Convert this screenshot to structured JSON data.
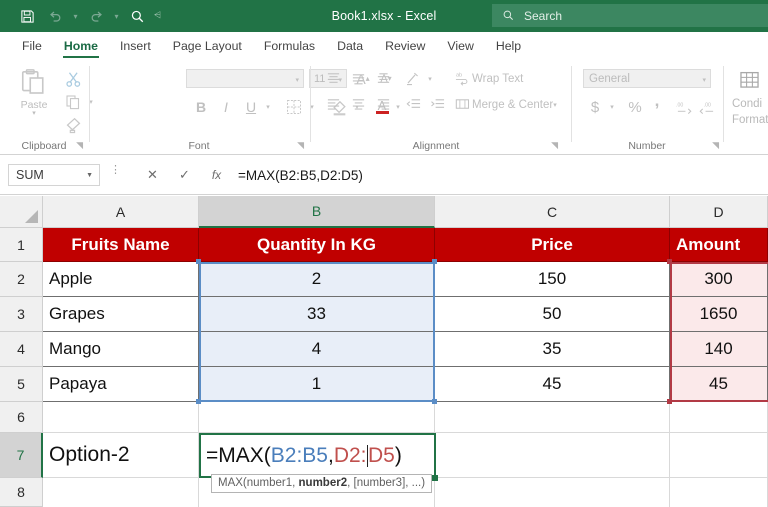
{
  "titlebar": {
    "document_title": "Book1.xlsx  -  Excel",
    "quick_access": [
      {
        "name": "save-icon",
        "label": "Save"
      },
      {
        "name": "undo-icon",
        "label": "Undo"
      },
      {
        "name": "redo-icon",
        "label": "Redo"
      },
      {
        "name": "search-icon",
        "label": "Search"
      },
      {
        "name": "customize-quick-access-icon",
        "label": "Customize Quick Access Toolbar"
      }
    ],
    "search": {
      "placeholder": "Search",
      "icon": "magnifier-icon"
    },
    "colors": {
      "bar": "#217346",
      "search_field": "#3c8761"
    }
  },
  "tabs": [
    {
      "label": "File",
      "active": false
    },
    {
      "label": "Home",
      "active": true
    },
    {
      "label": "Insert",
      "active": false
    },
    {
      "label": "Page Layout",
      "active": false
    },
    {
      "label": "Formulas",
      "active": false
    },
    {
      "label": "Data",
      "active": false
    },
    {
      "label": "Review",
      "active": false
    },
    {
      "label": "View",
      "active": false
    },
    {
      "label": "Help",
      "active": false
    }
  ],
  "ribbon": {
    "groups": [
      {
        "label": "Clipboard"
      },
      {
        "label": "Font"
      },
      {
        "label": "Alignment"
      },
      {
        "label": "Number"
      },
      {
        "label": "Conditional Formatting"
      }
    ],
    "clipboard": {
      "paste_label": "Paste",
      "cut_icon": "scissors-icon",
      "copy_icon": "copy-icon",
      "format_painter_icon": "format-painter-icon"
    },
    "font": {
      "font_name_value": "",
      "font_size_value": "11",
      "grow_font_label": "A",
      "shrink_font_label": "A",
      "bold_label": "B",
      "italic_label": "I",
      "underline_label": "U",
      "borders_icon": "borders-icon",
      "fill_color_icon": "fill-color-icon",
      "font_color_label": "A"
    },
    "alignment": {
      "wrap_text_label": "Wrap Text",
      "merge_center_label": "Merge & Center",
      "orientation_icon": "orientation-icon",
      "decrease_indent_icon": "decrease-indent-icon",
      "increase_indent_icon": "increase-indent-icon"
    },
    "number": {
      "format_value": "General",
      "accounting_label": "$",
      "percent_label": "%",
      "comma_label": ",",
      "increase_decimal_icon": "increase-decimal-icon",
      "decrease_decimal_icon": "decrease-decimal-icon"
    },
    "styles": {
      "conditional_formatting_line1": "Condi",
      "conditional_formatting_line2": "Format"
    }
  },
  "formula_bar": {
    "name_box_value": "SUM",
    "cancel_label": "✕",
    "enter_label": "✓",
    "function_label": "fx",
    "formula_value": "=MAX(B2:B5,D2:D5)"
  },
  "grid": {
    "column_headers": [
      {
        "label": "A",
        "selected": false
      },
      {
        "label": "B",
        "selected": true
      },
      {
        "label": "C",
        "selected": false
      },
      {
        "label": "D",
        "selected": false
      }
    ],
    "row_headers": [
      {
        "label": "1",
        "selected": false
      },
      {
        "label": "2",
        "selected": false
      },
      {
        "label": "3",
        "selected": false
      },
      {
        "label": "4",
        "selected": false
      },
      {
        "label": "5",
        "selected": false
      },
      {
        "label": "6",
        "selected": false
      },
      {
        "label": "7",
        "selected": true
      },
      {
        "label": "8",
        "selected": false
      }
    ],
    "header_row": [
      "Fruits Name",
      "Quantity In KG",
      "Price",
      "Amount"
    ],
    "rows": [
      {
        "a": "Apple",
        "b": "2",
        "c": "150",
        "d": "300"
      },
      {
        "a": "Grapes",
        "b": "33",
        "c": "50",
        "d": "1650"
      },
      {
        "a": "Mango",
        "b": "4",
        "c": "35",
        "d": "140"
      },
      {
        "a": "Papaya",
        "b": "1",
        "c": "45",
        "d": "45"
      }
    ],
    "option_label": "Option-2",
    "edit_formula": {
      "prefix": "=MAX(",
      "range1": "B2:B5",
      "comma": ",",
      "range2": "D2:",
      "range2b": "D5",
      "suffix": ")"
    },
    "tooltip": {
      "before": "MAX(number1, ",
      "bold": "number2",
      "after": ", [number3], ...)"
    },
    "colors": {
      "header_fill": "#c00000",
      "selection_blue": "#5b8dc6",
      "selection_blue_fill": "#e8eef8",
      "selection_red": "#b23a45",
      "selection_red_fill": "#fbe9ea",
      "active_cell_border": "#217346"
    }
  }
}
